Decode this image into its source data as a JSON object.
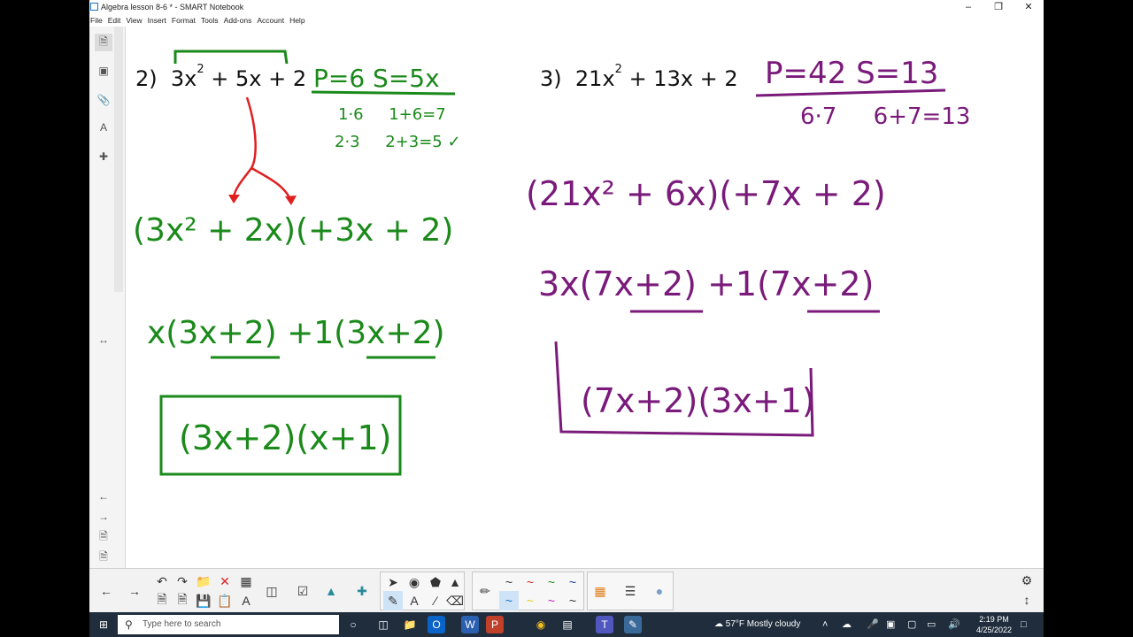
{
  "window": {
    "title": "Algebra lesson 8-6 * - SMART Notebook"
  },
  "menu": [
    "File",
    "Edit",
    "View",
    "Insert",
    "Format",
    "Tools",
    "Add-ons",
    "Account",
    "Help"
  ],
  "problems": {
    "p2": {
      "label": "2)",
      "coef": "3x",
      "exp": "2",
      "rest": " + 5x + 2"
    },
    "p3": {
      "label": "3)",
      "coef": "21x",
      "exp": "2",
      "rest": " + 13x + 2"
    }
  },
  "handwriting": {
    "p2_ps": "P=6  S=5x",
    "p2_pairs1": "1·6     1+6=7",
    "p2_pairs2": "2·3     2+3=5 ✓",
    "p2_split": "(3x² + 2x)(+3x + 2)",
    "p2_factor": "x(3x+2) +1(3x+2)",
    "p2_answer": "(3x+2)(x+1)",
    "p3_ps": "P=42  S=13",
    "p3_pairs": "6·7     6+7=13",
    "p3_split": "(21x² + 6x)(+7x + 2)",
    "p3_factor": "3x(7x+2) +1(7x+2)",
    "p3_answer": "(7x+2)(3x+1)"
  },
  "colors": {
    "green": "#1a8a1a",
    "purple": "#7a1a7a",
    "red": "#e02020"
  },
  "search": {
    "placeholder": "Type here to search"
  },
  "weather": {
    "temp": "57°F",
    "desc": "Mostly cloudy"
  },
  "clock": {
    "time": "2:19 PM",
    "date": "4/25/2022"
  }
}
